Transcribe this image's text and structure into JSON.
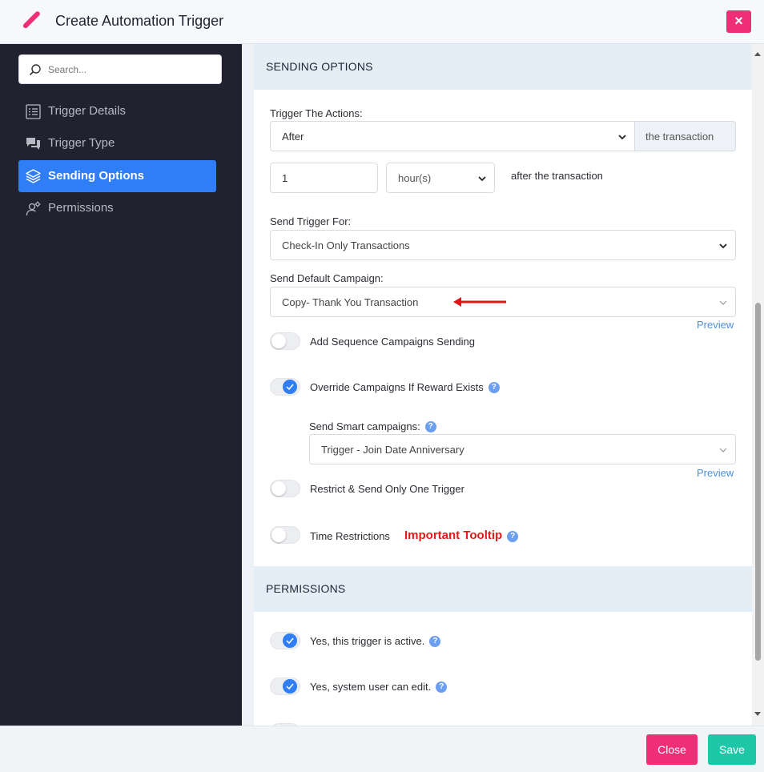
{
  "header": {
    "title": "Create Automation Trigger",
    "close_symbol": "×"
  },
  "sidebar": {
    "search_placeholder": "Search...",
    "items": [
      {
        "label": "Trigger Details",
        "icon": "list-icon"
      },
      {
        "label": "Trigger Type",
        "icon": "chat-icon"
      },
      {
        "label": "Sending Options",
        "icon": "layers-icon",
        "active": true
      },
      {
        "label": "Permissions",
        "icon": "user-gear-icon"
      }
    ]
  },
  "sending_options": {
    "heading": "SENDING OPTIONS",
    "trigger_actions_label": "Trigger The Actions:",
    "trigger_actions_value": "After",
    "trigger_actions_addon": "the transaction",
    "delay_value": "1",
    "delay_unit": "hour(s)",
    "delay_suffix": "after the transaction",
    "send_for_label": "Send Trigger For:",
    "send_for_value": "Check-In Only Transactions",
    "default_campaign_label": "Send Default Campaign:",
    "default_campaign_value": "Copy- Thank You Transaction",
    "preview_label": "Preview",
    "add_sequence_label": "Add Sequence Campaigns Sending",
    "override_label": "Override Campaigns If Reward Exists",
    "smart_campaigns_label": "Send Smart campaigns:",
    "smart_campaigns_value": "Trigger - Join Date Anniversary",
    "smart_preview_label": "Preview",
    "restrict_label": "Restrict & Send Only One Trigger",
    "time_restrictions_label": "Time Restrictions",
    "important_tooltip": "Important Tooltip"
  },
  "permissions": {
    "heading": "PERMISSIONS",
    "active_label": "Yes, this trigger is active.",
    "edit_label": "Yes, system user can edit."
  },
  "footer": {
    "close_label": "Close",
    "save_label": "Save"
  },
  "colors": {
    "accent": "#2f7ef5",
    "pink": "#ee2f76",
    "teal": "#1ec7a8",
    "sidebar": "#21212f",
    "important": "#e81818"
  }
}
